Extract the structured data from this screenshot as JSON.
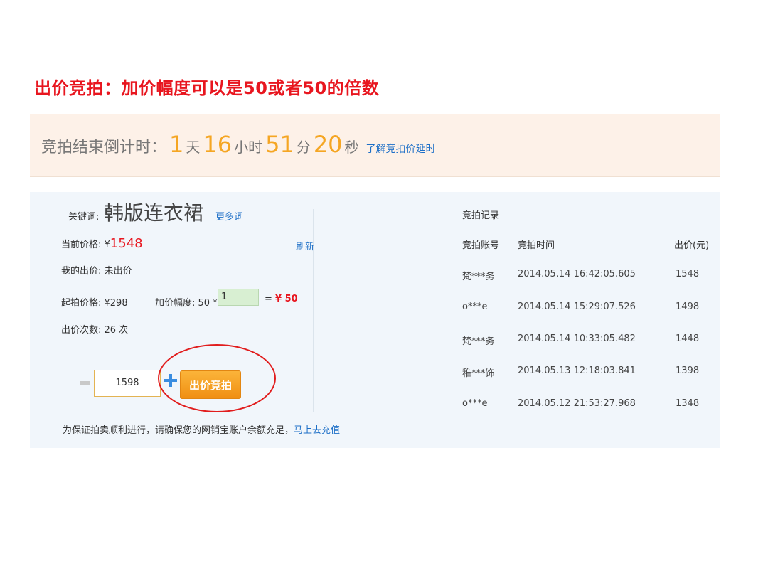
{
  "slide": {
    "title": "出价竞拍：加价幅度可以是50或者50的倍数"
  },
  "countdown": {
    "label": "竞拍结束倒计时：",
    "days": "1",
    "days_unit": "天",
    "hours": "16",
    "hours_unit": "小时",
    "minutes": "51",
    "minutes_unit": "分",
    "seconds": "20",
    "seconds_unit": "秒",
    "extend_link": "了解竞拍价延时"
  },
  "auction": {
    "keyword_label": "关键词:",
    "keyword": "韩版连衣裙",
    "more_link": "更多词",
    "current_price_label": "当前价格: ¥",
    "current_price": "1548",
    "refresh_link": "刷新",
    "my_bid_label": "我的出价: 未出价",
    "start_price_label": "起拍价格: ¥298",
    "increment_label": "加价幅度: 50 *",
    "increment_multiplier": "1",
    "increment_equals": "=",
    "increment_result": "¥ 50",
    "bid_count_label": "出价次数:  26 次",
    "bid_value": "1598",
    "bid_button": "出价竞拍",
    "notice_text": "为保证拍卖顺利进行，请确保您的网销宝账户余额充足，",
    "recharge_link": "马上去充值"
  },
  "records": {
    "title": "竞拍记录",
    "columns": [
      "竞拍账号",
      "竞拍时间",
      "出价(元)"
    ],
    "rows": [
      {
        "account": "梵***务",
        "time": "2014.05.14 16:42:05.605",
        "price": "1548"
      },
      {
        "account": "o***e",
        "time": "2014.05.14 15:29:07.526",
        "price": "1498"
      },
      {
        "account": "梵***务",
        "time": "2014.05.14 10:33:05.482",
        "price": "1448"
      },
      {
        "account": "稚***饰",
        "time": "2014.05.13 12:18:03.841",
        "price": "1398"
      },
      {
        "account": "o***e",
        "time": "2014.05.12 21:53:27.968",
        "price": "1348"
      }
    ]
  },
  "colors": {
    "title_red": "#e8161f",
    "countdown_orange": "#f5a623",
    "link_blue": "#1d6fc7",
    "button_orange": "#f08f12"
  }
}
